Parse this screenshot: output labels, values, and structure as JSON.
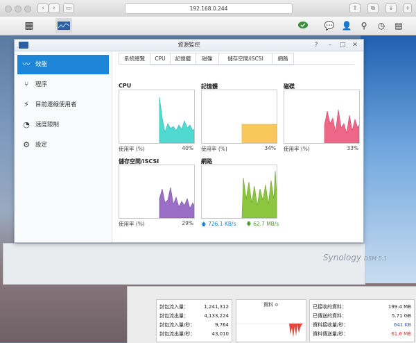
{
  "browser": {
    "url": "192.168.0.244"
  },
  "dsm": {
    "taskbar_right_icons": [
      "cloud-sync-icon",
      "chat-icon",
      "user-icon",
      "search-icon",
      "dashboard-icon",
      "widgets-icon"
    ]
  },
  "window": {
    "title": "資源監控",
    "controls": [
      "?",
      "–",
      "□",
      "✕"
    ]
  },
  "sidebar": {
    "items": [
      {
        "label": "效能",
        "icon": "performance-icon",
        "active": true
      },
      {
        "label": "程序",
        "icon": "process-icon",
        "active": false
      },
      {
        "label": "目前連線使用者",
        "icon": "connected-users-icon",
        "active": false
      },
      {
        "label": "速度限制",
        "icon": "speed-limit-icon",
        "active": false
      },
      {
        "label": "設定",
        "icon": "settings-icon",
        "active": false
      }
    ]
  },
  "tabs": [
    {
      "label": "系統總覽",
      "active": true
    },
    {
      "label": "CPU",
      "active": false
    },
    {
      "label": "記憶體",
      "active": false
    },
    {
      "label": "磁碟",
      "active": false
    },
    {
      "label": "儲存空間/iSCSI",
      "active": false
    },
    {
      "label": "網路",
      "active": false
    }
  ],
  "panels": {
    "cpu": {
      "title": "CPU",
      "usage_label": "使用率 (%)",
      "usage_value": "40%",
      "color": "#4fd9d0"
    },
    "memory": {
      "title": "記憶體",
      "usage_label": "使用率 (%)",
      "usage_value": "34%",
      "color": "#f8c95a"
    },
    "disk": {
      "title": "磁碟",
      "usage_label": "使用率 (%)",
      "usage_value": "33%",
      "color": "#ee6688"
    },
    "volume": {
      "title": "儲存空間/iSCSI",
      "usage_label": "使用率 (%)",
      "usage_value": "29%",
      "color": "#9b6fc6"
    },
    "network": {
      "title": "網路",
      "upload": "726.1 KB/s",
      "download": "62.7 MB/s",
      "color": "#8cc63f"
    }
  },
  "watermark": {
    "brand": "Synology",
    "product": "DSM 5.1"
  },
  "activity_monitor": {
    "packets": [
      {
        "label": "封包流入量：",
        "value": "1,241,312"
      },
      {
        "label": "封包流出量：",
        "value": "4,133,224"
      },
      {
        "label": "封包流入量/秒：",
        "value": "9,764"
      },
      {
        "label": "封包流出量/秒：",
        "value": "43,010"
      }
    ],
    "selector": "資料 ≎",
    "data": [
      {
        "label": "已接收的資料：",
        "value": "199.4 MB"
      },
      {
        "label": "已傳送的資料：",
        "value": "5.71 GB"
      },
      {
        "label": "資料接收量/秒：",
        "value": "641 KB"
      },
      {
        "label": "資料傳送量/秒：",
        "value": "61.6 MB"
      }
    ]
  }
}
